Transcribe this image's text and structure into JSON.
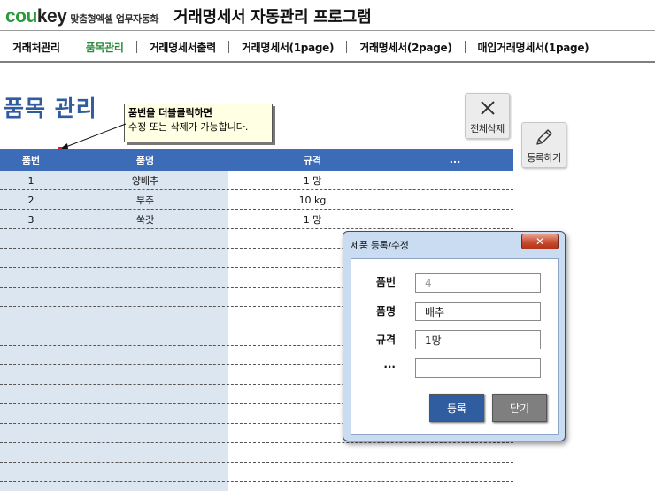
{
  "header": {
    "logo_part1": "cou",
    "logo_part2": "key",
    "logo_tagline": "맞춤형엑셀 업무자동화",
    "app_title": "거래명세서 자동관리 프로그램"
  },
  "nav": {
    "items": [
      {
        "label": "거래처관리"
      },
      {
        "label": "품목관리"
      },
      {
        "label": "거래명세서출력"
      },
      {
        "label": "거래명세서(1page)"
      },
      {
        "label": "거래명세서(2page)"
      },
      {
        "label": "매입거래명세서(1page)"
      }
    ],
    "active_index": 1
  },
  "page": {
    "title": "품목 관리",
    "tooltip_line1": "품번을 더블클릭하면",
    "tooltip_line2": "수정 또는 삭제가 가능합니다."
  },
  "toolbar": {
    "delete_all_label": "전체삭제",
    "register_label": "등록하기"
  },
  "table": {
    "headers": [
      "품번",
      "품명",
      "규격",
      "..."
    ],
    "rows": [
      [
        "1",
        "양배추",
        "1 망",
        ""
      ],
      [
        "2",
        "부추",
        "10 kg",
        ""
      ],
      [
        "3",
        "쑥갓",
        "1 망",
        ""
      ]
    ]
  },
  "dialog": {
    "title": "제품 등록/수정",
    "close_glyph": "✕",
    "fields": [
      {
        "label": "품번",
        "value": "4",
        "disabled": true
      },
      {
        "label": "품명",
        "value": "배추"
      },
      {
        "label": "규격",
        "value": "1망"
      },
      {
        "label": "...",
        "value": ""
      }
    ],
    "submit_label": "등록",
    "close_label": "닫기"
  },
  "colors": {
    "brand_green": "#2a9a3c",
    "title_blue": "#2f5c9e",
    "header_blue": "#3c6bb7",
    "column_shade": "#dce6f1",
    "dialog_frame": "#c9dcf1"
  }
}
